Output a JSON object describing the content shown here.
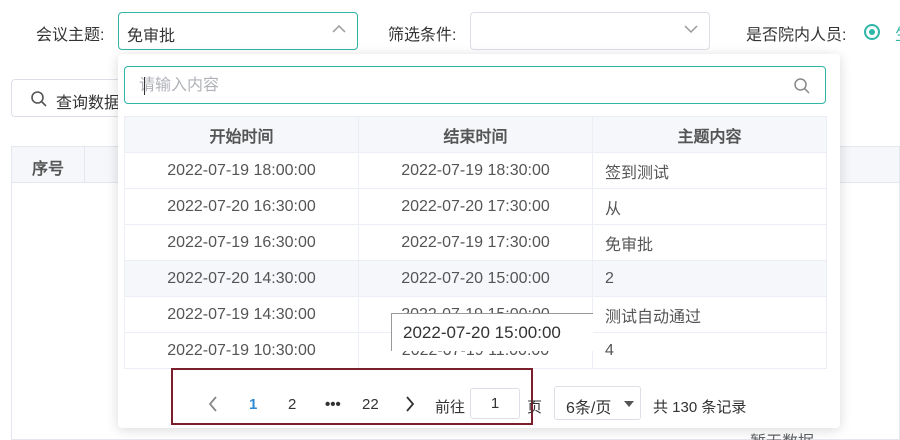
{
  "filters": {
    "topic_label": "会议主题:",
    "topic_value": "免审批",
    "condition_label": "筛选条件:",
    "condition_value": "",
    "in_hospital_label": "是否院内人员:",
    "in_hospital_option_partial": "生"
  },
  "query_button": {
    "label": "查询数据"
  },
  "background_table": {
    "seq_header": "序号",
    "empty_text": "暂无数据"
  },
  "dropdown": {
    "search_placeholder": "请输入内容",
    "columns": [
      "开始时间",
      "结束时间",
      "主题内容"
    ],
    "rows": [
      {
        "start": "2022-07-19 18:00:00",
        "end": "2022-07-19 18:30:00",
        "topic": "签到测试"
      },
      {
        "start": "2022-07-20 16:30:00",
        "end": "2022-07-20 17:30:00",
        "topic": "从"
      },
      {
        "start": "2022-07-19 16:30:00",
        "end": "2022-07-19 17:30:00",
        "topic": "免审批"
      },
      {
        "start": "2022-07-20 14:30:00",
        "end": "2022-07-20 15:00:00",
        "topic": "2"
      },
      {
        "start": "2022-07-19 14:30:00",
        "end": "2022-07-19 15:00:00",
        "topic": "测试自动通过"
      },
      {
        "start": "2022-07-19 10:30:00",
        "end": "2022-07-19 11:00:00",
        "topic": "4"
      }
    ],
    "tooltip": "2022-07-20 15:00:00",
    "pagination": {
      "pages": [
        "1",
        "2",
        "•••",
        "22"
      ],
      "current": "1",
      "goto_prefix": "前往",
      "goto_value": "1",
      "goto_suffix": "页",
      "page_size": "6条/页",
      "total": "共 130 条记录"
    }
  },
  "colors": {
    "accent": "#2fb6a7",
    "current_page": "#2b8bd6",
    "highlight_frame": "#7a1f2b"
  }
}
